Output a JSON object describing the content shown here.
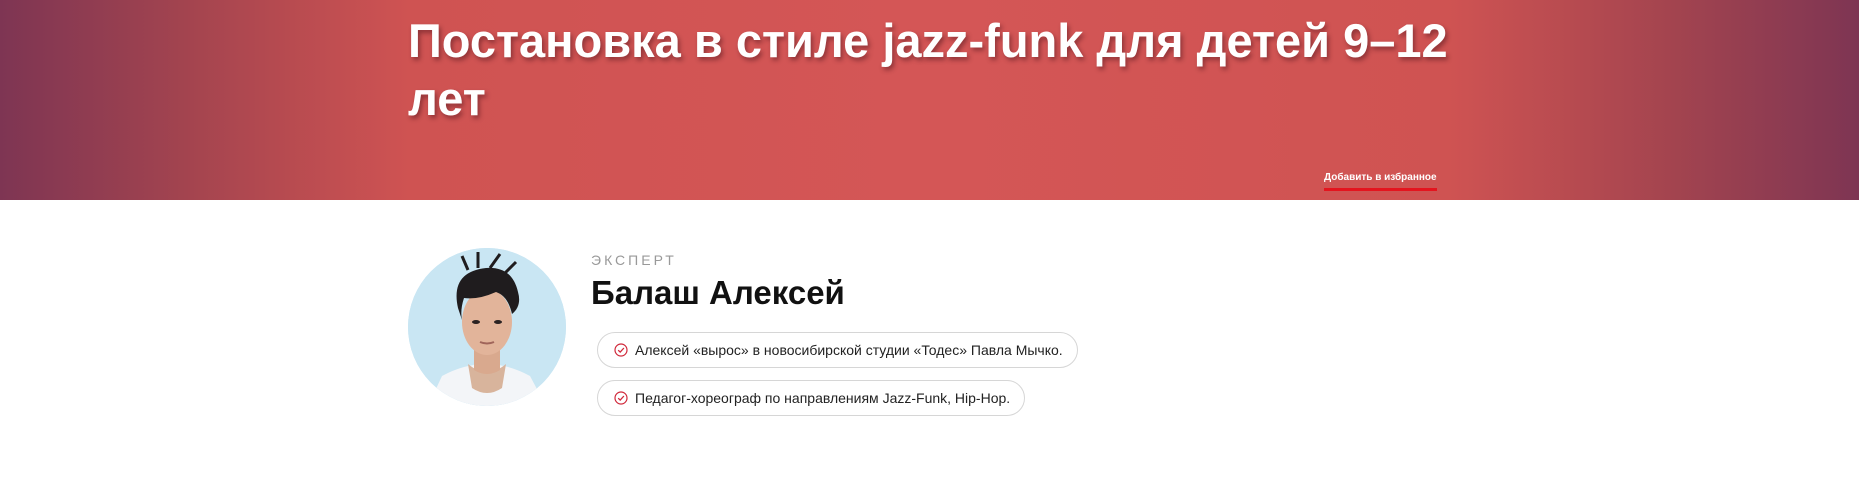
{
  "hero": {
    "title": "Постановка в стиле jazz-funk для детей 9–12 лет",
    "favorite_label": "Добавить в избранное"
  },
  "expert": {
    "label": "ЭКСПЕРТ",
    "name": "Балаш Алексей",
    "avatar_icon": "expert-photo",
    "facts": [
      {
        "text": "Алексей «вырос» в новосибирской студии «Тодес» Павла Мычко.",
        "icon": "check-circle-icon"
      },
      {
        "text": "Педагог-хореограф по направлениям Jazz-Funk, Hip-Hop.",
        "icon": "check-circle-icon"
      }
    ]
  },
  "colors": {
    "hero_center": "#d45656",
    "hero_edge": "#7e3553",
    "accent_red": "#e4141e",
    "check_icon": "#d0283a"
  }
}
